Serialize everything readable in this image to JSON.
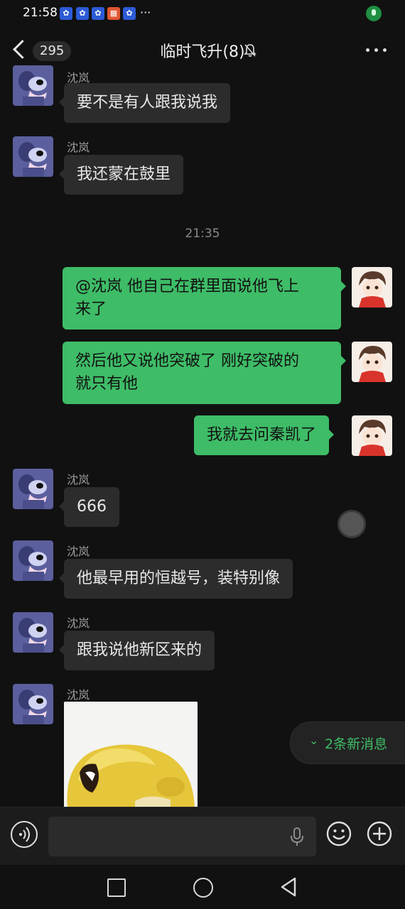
{
  "status_bar": {
    "time": "21:58",
    "app_icons": [
      "app-icon",
      "app-icon",
      "app-icon",
      "app-icon-red",
      "app-icon"
    ],
    "more": "···"
  },
  "header": {
    "unread_count": "295",
    "title": "临时飞升(8)"
  },
  "messages": [
    {
      "side": "in",
      "sender": "沈岚",
      "text": "要不是有人跟我说我"
    },
    {
      "side": "in",
      "sender": "沈岚",
      "text": "我还蒙在鼓里"
    },
    {
      "timestamp": "21:35"
    },
    {
      "side": "out",
      "text_line1": "@沈岚  他自己在群里面说他飞上",
      "text_line2": "来了"
    },
    {
      "side": "out",
      "text_line1": "然后他又说他突破了 刚好突破的",
      "text_line2": "就只有他"
    },
    {
      "side": "out",
      "text": "我就去问秦凯了"
    },
    {
      "side": "in",
      "sender": "沈岚",
      "text": "666"
    },
    {
      "side": "in",
      "sender": "沈岚",
      "text": "他最早用的恒越号，装特别像"
    },
    {
      "side": "in",
      "sender": "沈岚",
      "text": "跟我说他新区来的"
    },
    {
      "side": "in",
      "sender": "沈岚",
      "type": "image"
    }
  ],
  "new_messages": {
    "text": "2条新消息"
  },
  "input": {
    "value": "",
    "placeholder": ""
  },
  "colors": {
    "accent": "#3ebc67",
    "background": "#111111",
    "bubble_in": "#2c2c2c"
  }
}
